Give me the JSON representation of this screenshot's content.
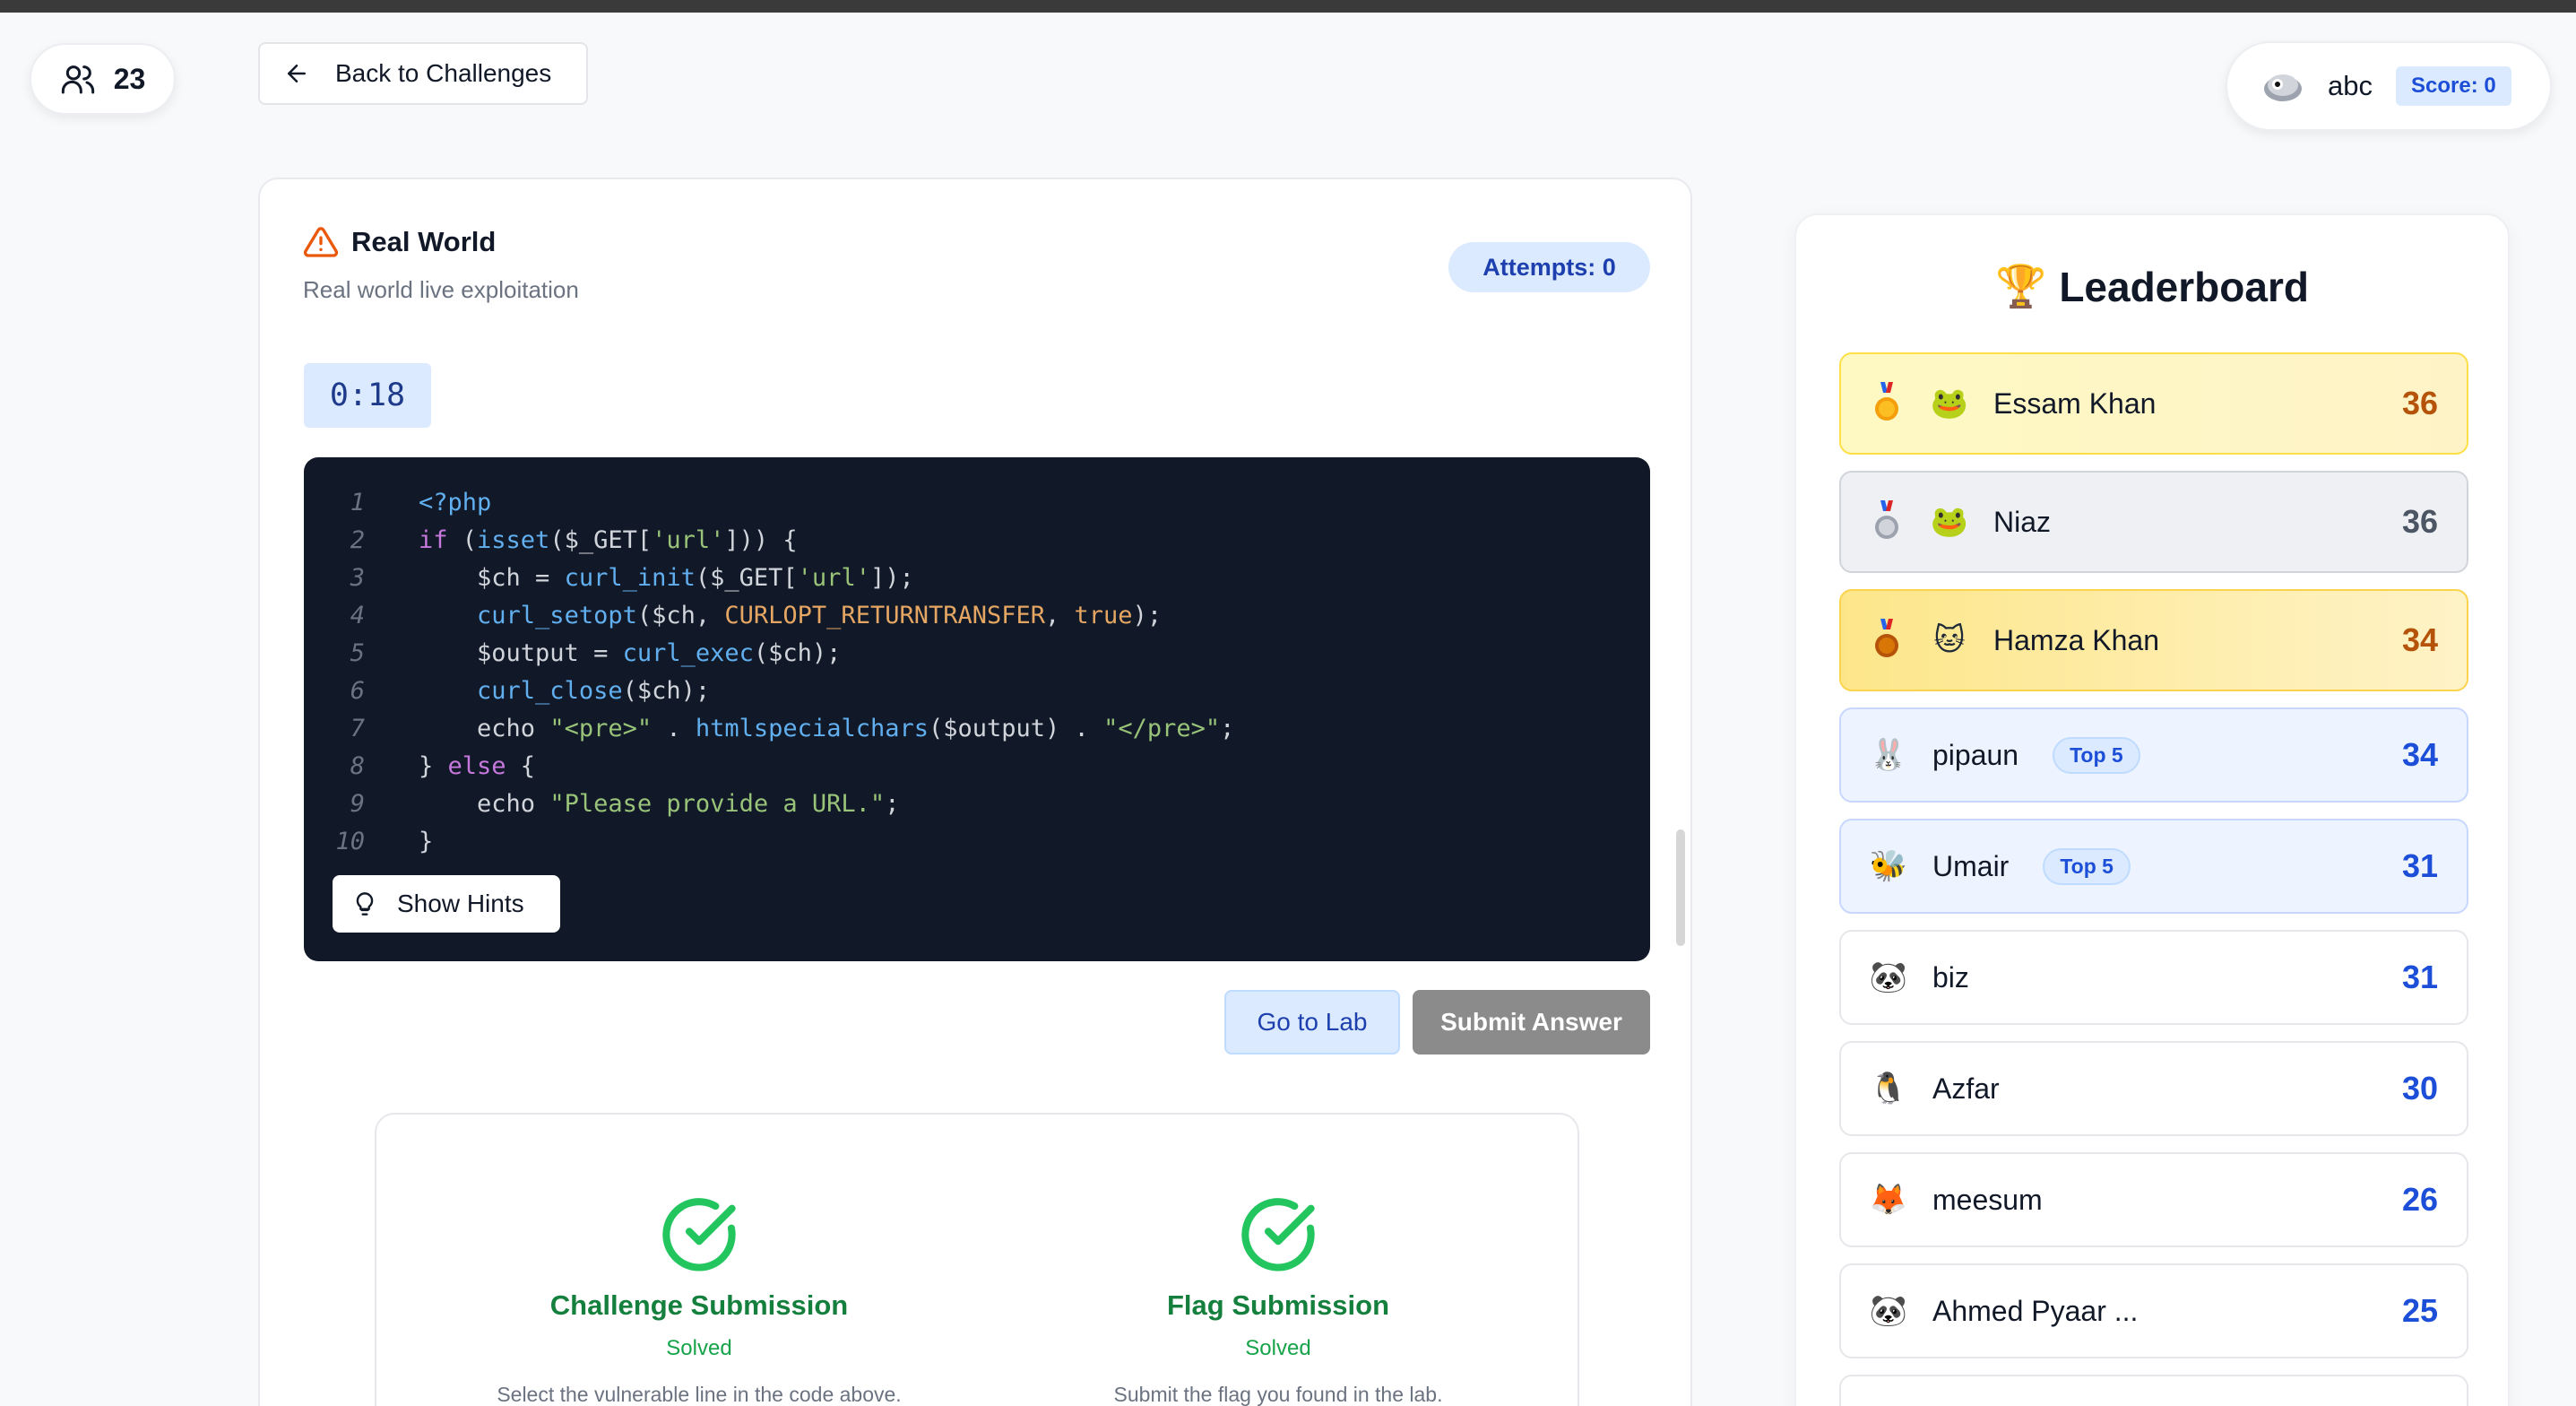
{
  "header": {
    "online_count": "23",
    "back_label": "Back to Challenges",
    "username": "abc",
    "score_label": "Score: 0"
  },
  "challenge": {
    "title": "Real World",
    "subtitle": "Real world live exploitation",
    "attempts_label": "Attempts: 0",
    "timer": "0:18",
    "code_lines": [
      "1",
      "2",
      "3",
      "4",
      "5",
      "6",
      "7",
      "8",
      "9",
      "10"
    ],
    "hints_label": "Show Hints",
    "lab_label": "Go to Lab",
    "submit_label": "Submit Answer"
  },
  "code_source": [
    "<?php",
    "if (isset($_GET['url'])) {",
    "    $ch = curl_init($_GET['url']);",
    "    curl_setopt($ch, CURLOPT_RETURNTRANSFER, true);",
    "    $output = curl_exec($ch);",
    "    curl_close($ch);",
    "    echo \"<pre>\" . htmlspecialchars($output) . \"</pre>\";",
    "} else {",
    "    echo \"Please provide a URL.\";",
    "}"
  ],
  "status": {
    "challenge_title": "Challenge Submission",
    "challenge_state": "Solved",
    "challenge_desc": "Select the vulnerable line in the code above.",
    "flag_title": "Flag Submission",
    "flag_state": "Solved",
    "flag_desc": "Submit the flag you found in the lab."
  },
  "leaderboard": {
    "title": "Leaderboard",
    "trophy": "🏆",
    "top5_label": "Top 5",
    "entries": [
      {
        "avatar": "🐸",
        "name": "Essam Khan",
        "score": "36"
      },
      {
        "avatar": "🐸",
        "name": "Niaz",
        "score": "36"
      },
      {
        "avatar": "🐱",
        "name": "Hamza Khan",
        "score": "34"
      },
      {
        "avatar": "🐰",
        "name": "pipaun",
        "score": "34"
      },
      {
        "avatar": "🐝",
        "name": "Umair",
        "score": "31"
      },
      {
        "avatar": "🐼",
        "name": "biz",
        "score": "31"
      },
      {
        "avatar": "🐧",
        "name": "Azfar",
        "score": "30"
      },
      {
        "avatar": "🦊",
        "name": "meesum",
        "score": "26"
      },
      {
        "avatar": "🐼",
        "name": "Ahmed Pyaar ...",
        "score": "25"
      }
    ]
  },
  "colors": {
    "accent": "#1d4ed8",
    "success": "#15803d",
    "warning": "#ea580c",
    "code_bg": "#111827"
  }
}
